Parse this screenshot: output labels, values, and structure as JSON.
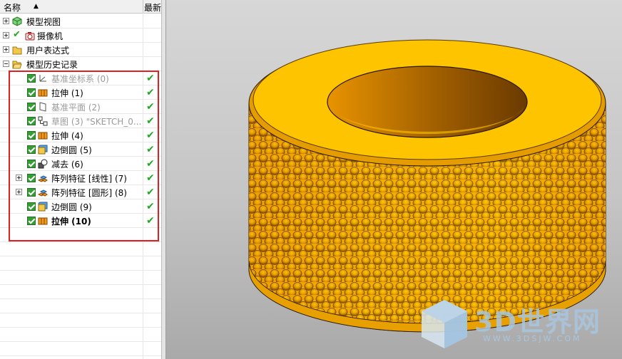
{
  "navigator": {
    "header": {
      "name_col": "名称",
      "latest_col": "最新",
      "sort_arrow": "▲"
    },
    "top_nodes": [
      {
        "label": "模型视图",
        "icon": "model-views-icon",
        "expander": "plus"
      },
      {
        "label": "摄像机",
        "icon": "camera-icon",
        "expander": "plus"
      },
      {
        "label": "用户表达式",
        "icon": "folder-icon",
        "expander": "plus"
      },
      {
        "label": "模型历史记录",
        "icon": "folder-open-icon",
        "expander": "minus"
      }
    ],
    "history": [
      {
        "label": "基准坐标系 (0)",
        "icon": "datum-csys-icon",
        "style": "grey",
        "status": "✔"
      },
      {
        "label": "拉伸 (1)",
        "icon": "extrude-icon",
        "style": "normal",
        "status": "✔"
      },
      {
        "label": "基准平面 (2)",
        "icon": "datum-plane-icon",
        "style": "grey",
        "status": "✔"
      },
      {
        "label": "草图 (3) \"SKETCH_0...",
        "icon": "sketch-icon",
        "style": "grey",
        "status": "✔"
      },
      {
        "label": "拉伸 (4)",
        "icon": "extrude-icon",
        "style": "normal",
        "status": "✔"
      },
      {
        "label": "边倒圆 (5)",
        "icon": "edge-blend-icon",
        "style": "normal",
        "status": "✔"
      },
      {
        "label": "减去 (6)",
        "icon": "subtract-icon",
        "style": "normal",
        "status": "✔"
      },
      {
        "label": "阵列特征 [线性] (7)",
        "icon": "pattern-feature-icon",
        "style": "normal",
        "status": "✔",
        "expander": "plus"
      },
      {
        "label": "阵列特征 [圆形] (8)",
        "icon": "pattern-feature-icon",
        "style": "normal",
        "status": "✔",
        "expander": "plus"
      },
      {
        "label": "边倒圆 (9)",
        "icon": "edge-blend-icon",
        "style": "normal",
        "status": "✔"
      },
      {
        "label": "拉伸 (10)",
        "icon": "extrude-icon",
        "style": "bold",
        "status": "✔"
      }
    ]
  },
  "viewport": {
    "model_color": "#f5b800",
    "watermark": {
      "text": "3D世界网",
      "url": "WWW.3DSJW.COM"
    }
  },
  "colors": {
    "highlight_box": "#e0201e",
    "check_green": "#22aa22"
  }
}
